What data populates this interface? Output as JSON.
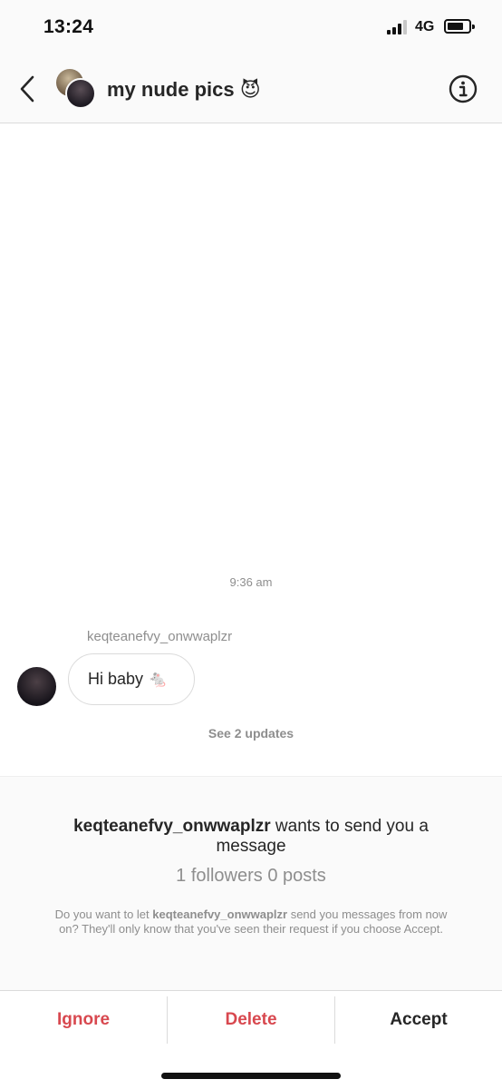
{
  "status_bar": {
    "time": "13:24",
    "network": "4G",
    "signal_icon": "signal-bars-icon",
    "battery_icon": "battery-icon"
  },
  "header": {
    "back_icon": "chevron-left-icon",
    "title": "my nude pics 😈",
    "info_icon": "info-icon"
  },
  "chat": {
    "timestamp": "9:36 am",
    "sender_name": "keqteanefvy_onwwaplzr",
    "message_text": "Hi baby 🐁",
    "see_updates": "See 2 updates"
  },
  "request": {
    "username": "keqteanefvy_onwwaplzr",
    "wants_text": " wants to send you a message",
    "stats": "1 followers 0 posts",
    "desc_prefix": "Do you want to let ",
    "desc_username": "keqteanefvy_onwwaplzr",
    "desc_suffix": " send you messages from now on? They'll only know that you've seen their request if you choose Accept."
  },
  "actions": {
    "ignore": "Ignore",
    "delete": "Delete",
    "accept": "Accept"
  },
  "colors": {
    "danger": "#d8484f",
    "muted": "#8e8e8e",
    "text": "#262626"
  }
}
